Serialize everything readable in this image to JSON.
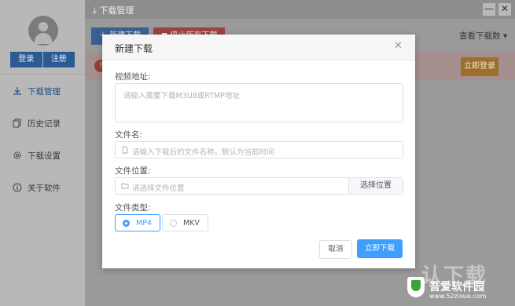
{
  "sidebar": {
    "login": "登录",
    "register": "注册",
    "items": [
      {
        "label": "下载管理",
        "icon": "download-icon"
      },
      {
        "label": "历史记录",
        "icon": "copy-icon"
      },
      {
        "label": "下载设置",
        "icon": "gear-icon"
      },
      {
        "label": "关于软件",
        "icon": "info-icon"
      }
    ]
  },
  "titlebar": {
    "title": "下载管理",
    "minimize": "—",
    "close": "✕"
  },
  "toolbar": {
    "new_download": "新建下载",
    "stop_all": "停止所有下载",
    "view_label": "查看下载数"
  },
  "notice": {
    "login_now": "立即登录"
  },
  "dialog": {
    "title": "新建下载",
    "video_label": "视频地址:",
    "video_placeholder": "请输入需要下载M3U8或RTMP地址",
    "filename_label": "文件名:",
    "filename_placeholder": "请输入下载后的文件名称，默认为当前时间",
    "location_label": "文件位置:",
    "location_placeholder": "请选择文件位置",
    "choose_button": "选择位置",
    "type_label": "文件类型:",
    "types": [
      "MP4",
      "MKV"
    ],
    "selected_type": "MP4",
    "cancel": "取消",
    "confirm": "立即下载"
  },
  "watermark": {
    "name": "吾爱软件园",
    "url": "www.52zixue.com"
  },
  "colors": {
    "accent": "#409eff",
    "sidebar_active": "#1f4f8a",
    "login_button": "#9c6f2a"
  }
}
